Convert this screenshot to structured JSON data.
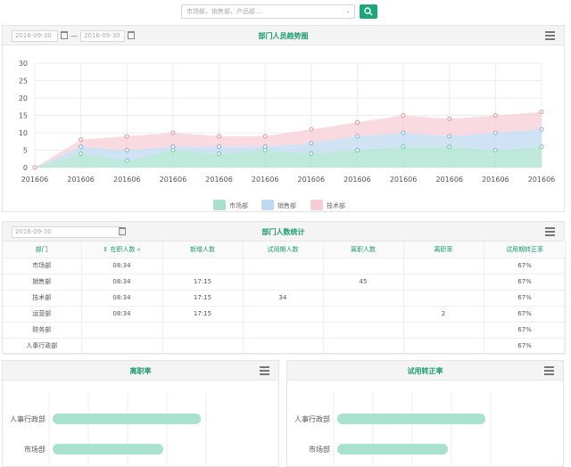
{
  "search": {
    "placeholder": "市场部，销售部，产品部...",
    "button_icon": "search-icon"
  },
  "trend_panel": {
    "title": "部门人员趋势图",
    "date_from": "2016-09-30",
    "date_to": "2016-09-30",
    "date_separator": "—",
    "menu_icon": "menu-icon"
  },
  "chart_data": [
    {
      "type": "area",
      "title": "部门人员趋势图",
      "categories": [
        "201606",
        "201606",
        "201606",
        "201606",
        "201606",
        "201606",
        "201606",
        "201606",
        "201606",
        "201606",
        "201606",
        "201606"
      ],
      "ylim": [
        0,
        30
      ],
      "yticks": [
        0,
        5,
        10,
        15,
        20,
        25,
        30
      ],
      "grid": true,
      "legend_position": "bottom",
      "series": [
        {
          "name": "市场部",
          "color": "#a8e2cf",
          "values": [
            0,
            4,
            2,
            5,
            4,
            5,
            4,
            5,
            6,
            6,
            5,
            6
          ]
        },
        {
          "name": "销售部",
          "color": "#bfd9f2",
          "values": [
            0,
            6,
            5,
            6,
            6,
            6,
            7,
            9,
            10,
            9,
            10,
            11
          ]
        },
        {
          "name": "技术部",
          "color": "#f6cdd5",
          "values": [
            0,
            8,
            9,
            10,
            9,
            9,
            11,
            13,
            15,
            14,
            15,
            16
          ]
        }
      ]
    },
    {
      "type": "bar",
      "title": "离职率",
      "categories": [
        "人事行政部",
        "市场部"
      ],
      "values": [
        67,
        50
      ],
      "color": "#a8e2cf"
    },
    {
      "type": "bar",
      "title": "试用转正率",
      "categories": [
        "人事行政部",
        "市场部"
      ],
      "values": [
        67,
        50
      ],
      "color": "#a8e2cf"
    }
  ],
  "stats_panel": {
    "title": "部门人数统计",
    "date": "2016-09-30",
    "columns": [
      "部门",
      "在职人数",
      "新增人数",
      "试用期人数",
      "离职人数",
      "离职率",
      "试用期转正率"
    ],
    "rows": [
      [
        "市场部",
        "08:34",
        "",
        "",
        "",
        "",
        "67%"
      ],
      [
        "销售部",
        "08:34",
        "17:15",
        "",
        "45",
        "",
        "67%"
      ],
      [
        "技术部",
        "08:34",
        "17:15",
        "34",
        "",
        "",
        "67%"
      ],
      [
        "运营部",
        "08:34",
        "17:15",
        "",
        "",
        "2",
        "67%"
      ],
      [
        "财务部",
        "",
        "",
        "",
        "",
        "",
        "67%"
      ],
      [
        "人事行政部",
        "",
        "",
        "",
        "",
        "",
        "67%"
      ]
    ]
  },
  "turnover_panel": {
    "title": "离职率"
  },
  "probation_panel": {
    "title": "试用转正率"
  }
}
